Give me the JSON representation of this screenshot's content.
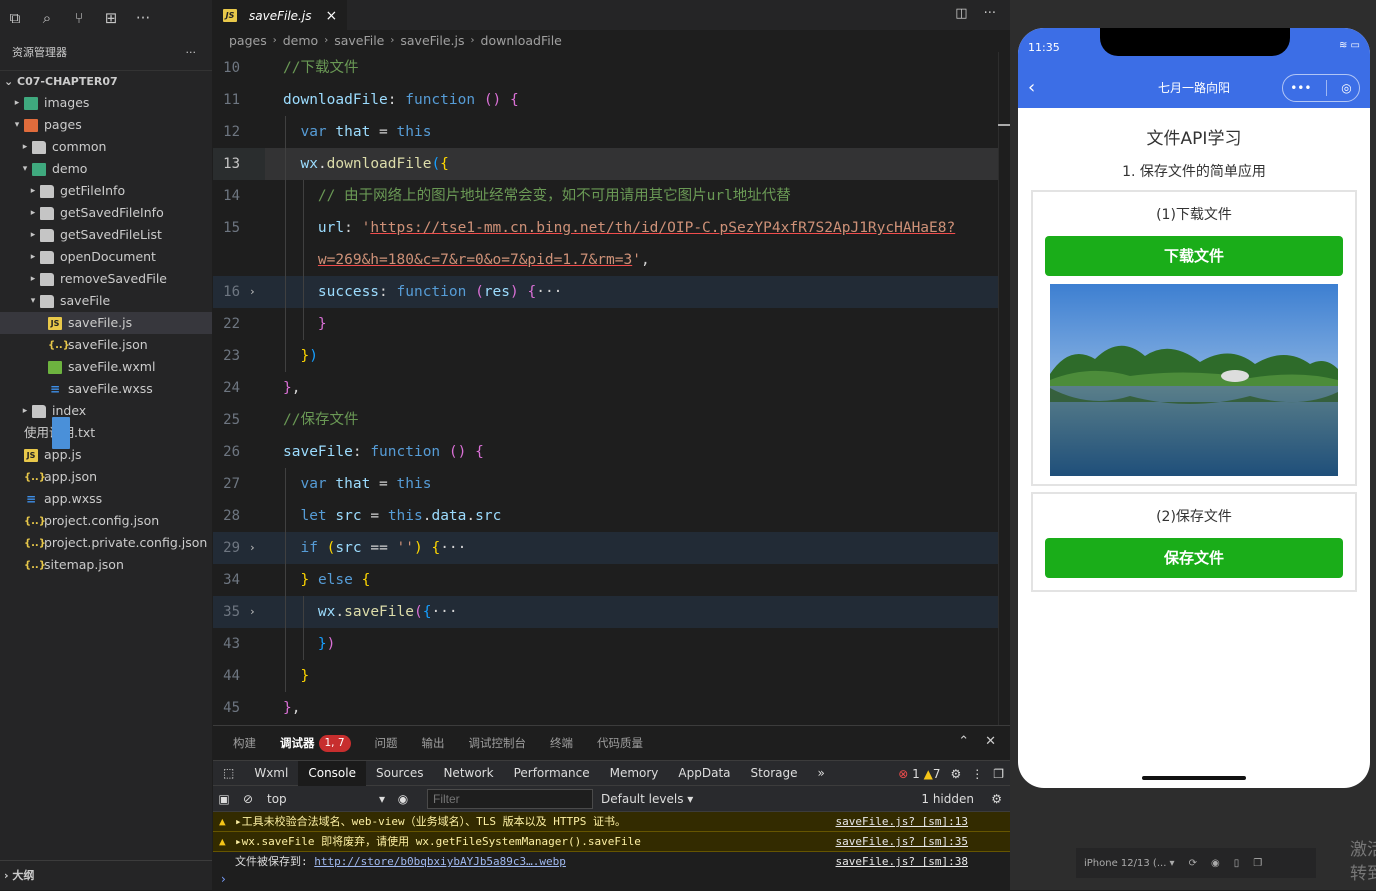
{
  "explorer": {
    "title": "资源管理器",
    "more": "···",
    "project": "C07-CHAPTER07",
    "outline": "大纲",
    "items": [
      {
        "label": "images",
        "depth": 1,
        "arrow": "right",
        "icon": "folder-img"
      },
      {
        "label": "pages",
        "depth": 1,
        "arrow": "down",
        "icon": "folder-pg"
      },
      {
        "label": "common",
        "depth": 2,
        "arrow": "right",
        "icon": "folder"
      },
      {
        "label": "demo",
        "depth": 2,
        "arrow": "down",
        "icon": "folder-demo"
      },
      {
        "label": "getFileInfo",
        "depth": 3,
        "arrow": "right",
        "icon": "folder"
      },
      {
        "label": "getSavedFileInfo",
        "depth": 3,
        "arrow": "right",
        "icon": "folder"
      },
      {
        "label": "getSavedFileList",
        "depth": 3,
        "arrow": "right",
        "icon": "folder"
      },
      {
        "label": "openDocument",
        "depth": 3,
        "arrow": "right",
        "icon": "folder"
      },
      {
        "label": "removeSavedFile",
        "depth": 3,
        "arrow": "right",
        "icon": "folder"
      },
      {
        "label": "saveFile",
        "depth": 3,
        "arrow": "down",
        "icon": "folder"
      },
      {
        "label": "saveFile.js",
        "depth": 4,
        "arrow": "",
        "icon": "js",
        "selected": true
      },
      {
        "label": "saveFile.json",
        "depth": 4,
        "arrow": "",
        "icon": "json"
      },
      {
        "label": "saveFile.wxml",
        "depth": 4,
        "arrow": "",
        "icon": "wxml"
      },
      {
        "label": "saveFile.wxss",
        "depth": 4,
        "arrow": "",
        "icon": "wxss"
      },
      {
        "label": "index",
        "depth": 2,
        "arrow": "right",
        "icon": "folder"
      },
      {
        "label": "使用说明.txt",
        "depth": 1,
        "arrow": "",
        "icon": "txt"
      },
      {
        "label": "app.js",
        "depth": 1,
        "arrow": "",
        "icon": "js"
      },
      {
        "label": "app.json",
        "depth": 1,
        "arrow": "",
        "icon": "json"
      },
      {
        "label": "app.wxss",
        "depth": 1,
        "arrow": "",
        "icon": "wxss"
      },
      {
        "label": "project.config.json",
        "depth": 1,
        "arrow": "",
        "icon": "json"
      },
      {
        "label": "project.private.config.json",
        "depth": 1,
        "arrow": "",
        "icon": "json"
      },
      {
        "label": "sitemap.json",
        "depth": 1,
        "arrow": "",
        "icon": "json"
      }
    ]
  },
  "editor": {
    "tab": "saveFile.js",
    "tab_close": "×",
    "breadcrumbs": [
      "pages",
      "demo",
      "saveFile",
      "saveFile.js",
      "downloadFile"
    ],
    "lines": [
      {
        "n": "10",
        "ind": 1,
        "tok": [
          [
            "c-cm",
            "//下载文件"
          ]
        ]
      },
      {
        "n": "11",
        "ind": 1,
        "tok": [
          [
            "c-prop",
            "downloadFile"
          ],
          [
            "c-pln",
            ": "
          ],
          [
            "c-kw",
            "function"
          ],
          [
            "c-pln",
            " "
          ],
          [
            "c-br2",
            "()"
          ],
          [
            "c-pln",
            " "
          ],
          [
            "c-br2",
            "{"
          ]
        ]
      },
      {
        "n": "12",
        "ind": 2,
        "tok": [
          [
            "c-kw",
            "var"
          ],
          [
            "c-pln",
            " "
          ],
          [
            "c-var",
            "that"
          ],
          [
            "c-pln",
            " = "
          ],
          [
            "c-this",
            "this"
          ]
        ]
      },
      {
        "n": "13",
        "ind": 2,
        "cur": true,
        "tok": [
          [
            "c-var",
            "wx"
          ],
          [
            "c-pln",
            "."
          ],
          [
            "c-fn",
            "downloadFile"
          ],
          [
            "c-br3",
            "("
          ],
          [
            "c-br1",
            "{"
          ]
        ]
      },
      {
        "n": "14",
        "ind": 3,
        "tok": [
          [
            "c-cm",
            "// 由于网络上的图片地址经常会变，如不可用请用其它图片url地址代替"
          ]
        ]
      },
      {
        "n": "15",
        "ind": 3,
        "tok": [
          [
            "c-prop",
            "url"
          ],
          [
            "c-pln",
            ": "
          ],
          [
            "c-str",
            "'"
          ],
          [
            "c-url",
            "https://tse1-mm.cn.bing.net/th/id/OIP-C.pSezYP4xfR7S2ApJ1RycHAHaE8?"
          ]
        ]
      },
      {
        "n": "",
        "ind": 3,
        "tok": [
          [
            "c-url",
            "w=269&h=180&c=7&r=0&o=7&pid=1.7&rm=3"
          ],
          [
            "c-str",
            "'"
          ],
          [
            "c-pln",
            ","
          ]
        ]
      },
      {
        "n": "16",
        "ind": 3,
        "fold": true,
        "tok": [
          [
            "c-prop",
            "success"
          ],
          [
            "c-pln",
            ": "
          ],
          [
            "c-kw",
            "function"
          ],
          [
            "c-pln",
            " "
          ],
          [
            "c-br2",
            "("
          ],
          [
            "c-pm",
            "res"
          ],
          [
            "c-br2",
            ")"
          ],
          [
            "c-pln",
            " "
          ],
          [
            "c-br2",
            "{"
          ],
          [
            "c-pln",
            "···"
          ]
        ]
      },
      {
        "n": "22",
        "ind": 3,
        "tok": [
          [
            "c-br2",
            "}"
          ]
        ]
      },
      {
        "n": "23",
        "ind": 2,
        "tok": [
          [
            "c-br1",
            "}"
          ],
          [
            "c-br3",
            ")"
          ]
        ]
      },
      {
        "n": "24",
        "ind": 1,
        "tok": [
          [
            "c-br2",
            "}"
          ],
          [
            "c-pln",
            ","
          ]
        ]
      },
      {
        "n": "25",
        "ind": 1,
        "tok": [
          [
            "c-cm",
            "//保存文件"
          ]
        ]
      },
      {
        "n": "26",
        "ind": 1,
        "tok": [
          [
            "c-prop",
            "saveFile"
          ],
          [
            "c-pln",
            ": "
          ],
          [
            "c-kw",
            "function"
          ],
          [
            "c-pln",
            " "
          ],
          [
            "c-br2",
            "()"
          ],
          [
            "c-pln",
            " "
          ],
          [
            "c-br2",
            "{"
          ]
        ]
      },
      {
        "n": "27",
        "ind": 2,
        "tok": [
          [
            "c-kw",
            "var"
          ],
          [
            "c-pln",
            " "
          ],
          [
            "c-var",
            "that"
          ],
          [
            "c-pln",
            " = "
          ],
          [
            "c-this",
            "this"
          ]
        ]
      },
      {
        "n": "28",
        "ind": 2,
        "tok": [
          [
            "c-kw",
            "let"
          ],
          [
            "c-pln",
            " "
          ],
          [
            "c-var",
            "src"
          ],
          [
            "c-pln",
            " = "
          ],
          [
            "c-this",
            "this"
          ],
          [
            "c-pln",
            "."
          ],
          [
            "c-var",
            "data"
          ],
          [
            "c-pln",
            "."
          ],
          [
            "c-var",
            "src"
          ]
        ]
      },
      {
        "n": "29",
        "ind": 2,
        "fold": true,
        "tok": [
          [
            "c-kw",
            "if"
          ],
          [
            "c-pln",
            " "
          ],
          [
            "c-br1",
            "("
          ],
          [
            "c-var",
            "src"
          ],
          [
            "c-pln",
            " == "
          ],
          [
            "c-str",
            "''"
          ],
          [
            "c-br1",
            ")"
          ],
          [
            "c-pln",
            " "
          ],
          [
            "c-br1",
            "{"
          ],
          [
            "c-pln",
            "···"
          ]
        ]
      },
      {
        "n": "34",
        "ind": 2,
        "tok": [
          [
            "c-br1",
            "}"
          ],
          [
            "c-pln",
            " "
          ],
          [
            "c-kw",
            "else"
          ],
          [
            "c-pln",
            " "
          ],
          [
            "c-br1",
            "{"
          ]
        ]
      },
      {
        "n": "35",
        "ind": 3,
        "fold": true,
        "tok": [
          [
            "c-var",
            "wx"
          ],
          [
            "c-pln",
            "."
          ],
          [
            "c-fn",
            "saveFile"
          ],
          [
            "c-br2",
            "("
          ],
          [
            "c-br3",
            "{"
          ],
          [
            "c-pln",
            "···"
          ]
        ]
      },
      {
        "n": "43",
        "ind": 3,
        "tok": [
          [
            "c-br3",
            "}"
          ],
          [
            "c-br2",
            ")"
          ]
        ]
      },
      {
        "n": "44",
        "ind": 2,
        "tok": [
          [
            "c-br1",
            "}"
          ]
        ]
      },
      {
        "n": "45",
        "ind": 1,
        "tok": [
          [
            "c-br2",
            "}"
          ],
          [
            "c-pln",
            ","
          ]
        ]
      }
    ]
  },
  "panel": {
    "tabs": [
      "构建",
      "调试器",
      "问题",
      "输出",
      "调试控制台",
      "终端",
      "代码质量"
    ],
    "active": "调试器",
    "badge": "1, 7",
    "devtools": [
      "Wxml",
      "Console",
      "Sources",
      "Network",
      "Performance",
      "Memory",
      "AppData",
      "Storage"
    ],
    "devtools_active": "Console",
    "more": "»",
    "errors": "1",
    "warnings": "7",
    "context": "top",
    "filter_placeholder": "Filter",
    "levels": "Default levels ▾",
    "hidden": "1 hidden",
    "logs": [
      {
        "type": "warn",
        "text": "▸工具未校验合法域名、web-view（业务域名）、TLS 版本以及 HTTPS 证书。",
        "src": "saveFile.js? [sm]:13"
      },
      {
        "type": "warn",
        "text": "▸wx.saveFile 即将废弃，请使用 wx.getFileSystemManager().saveFile",
        "src": "saveFile.js? [sm]:35"
      },
      {
        "type": "info",
        "text": "文件被保存到: ",
        "link": "http://store/b0bqbxiybAYJb5a89c3….webp",
        "src": "saveFile.js? [sm]:38"
      }
    ],
    "prompt": "›"
  },
  "simulator": {
    "time": "11:35",
    "nav_title": "七月一路向阳",
    "page_title": "文件API学习",
    "subtitle": "1. 保存文件的简单应用",
    "section1": "(1)下载文件",
    "button1": "下载文件",
    "section2": "(2)保存文件",
    "button2": "保存文件",
    "device": "iPhone 12/13 (... ▾",
    "watermark": "激活\n转到"
  },
  "colors": {
    "accent": "#3c6ee6",
    "button": "#1aad19"
  }
}
